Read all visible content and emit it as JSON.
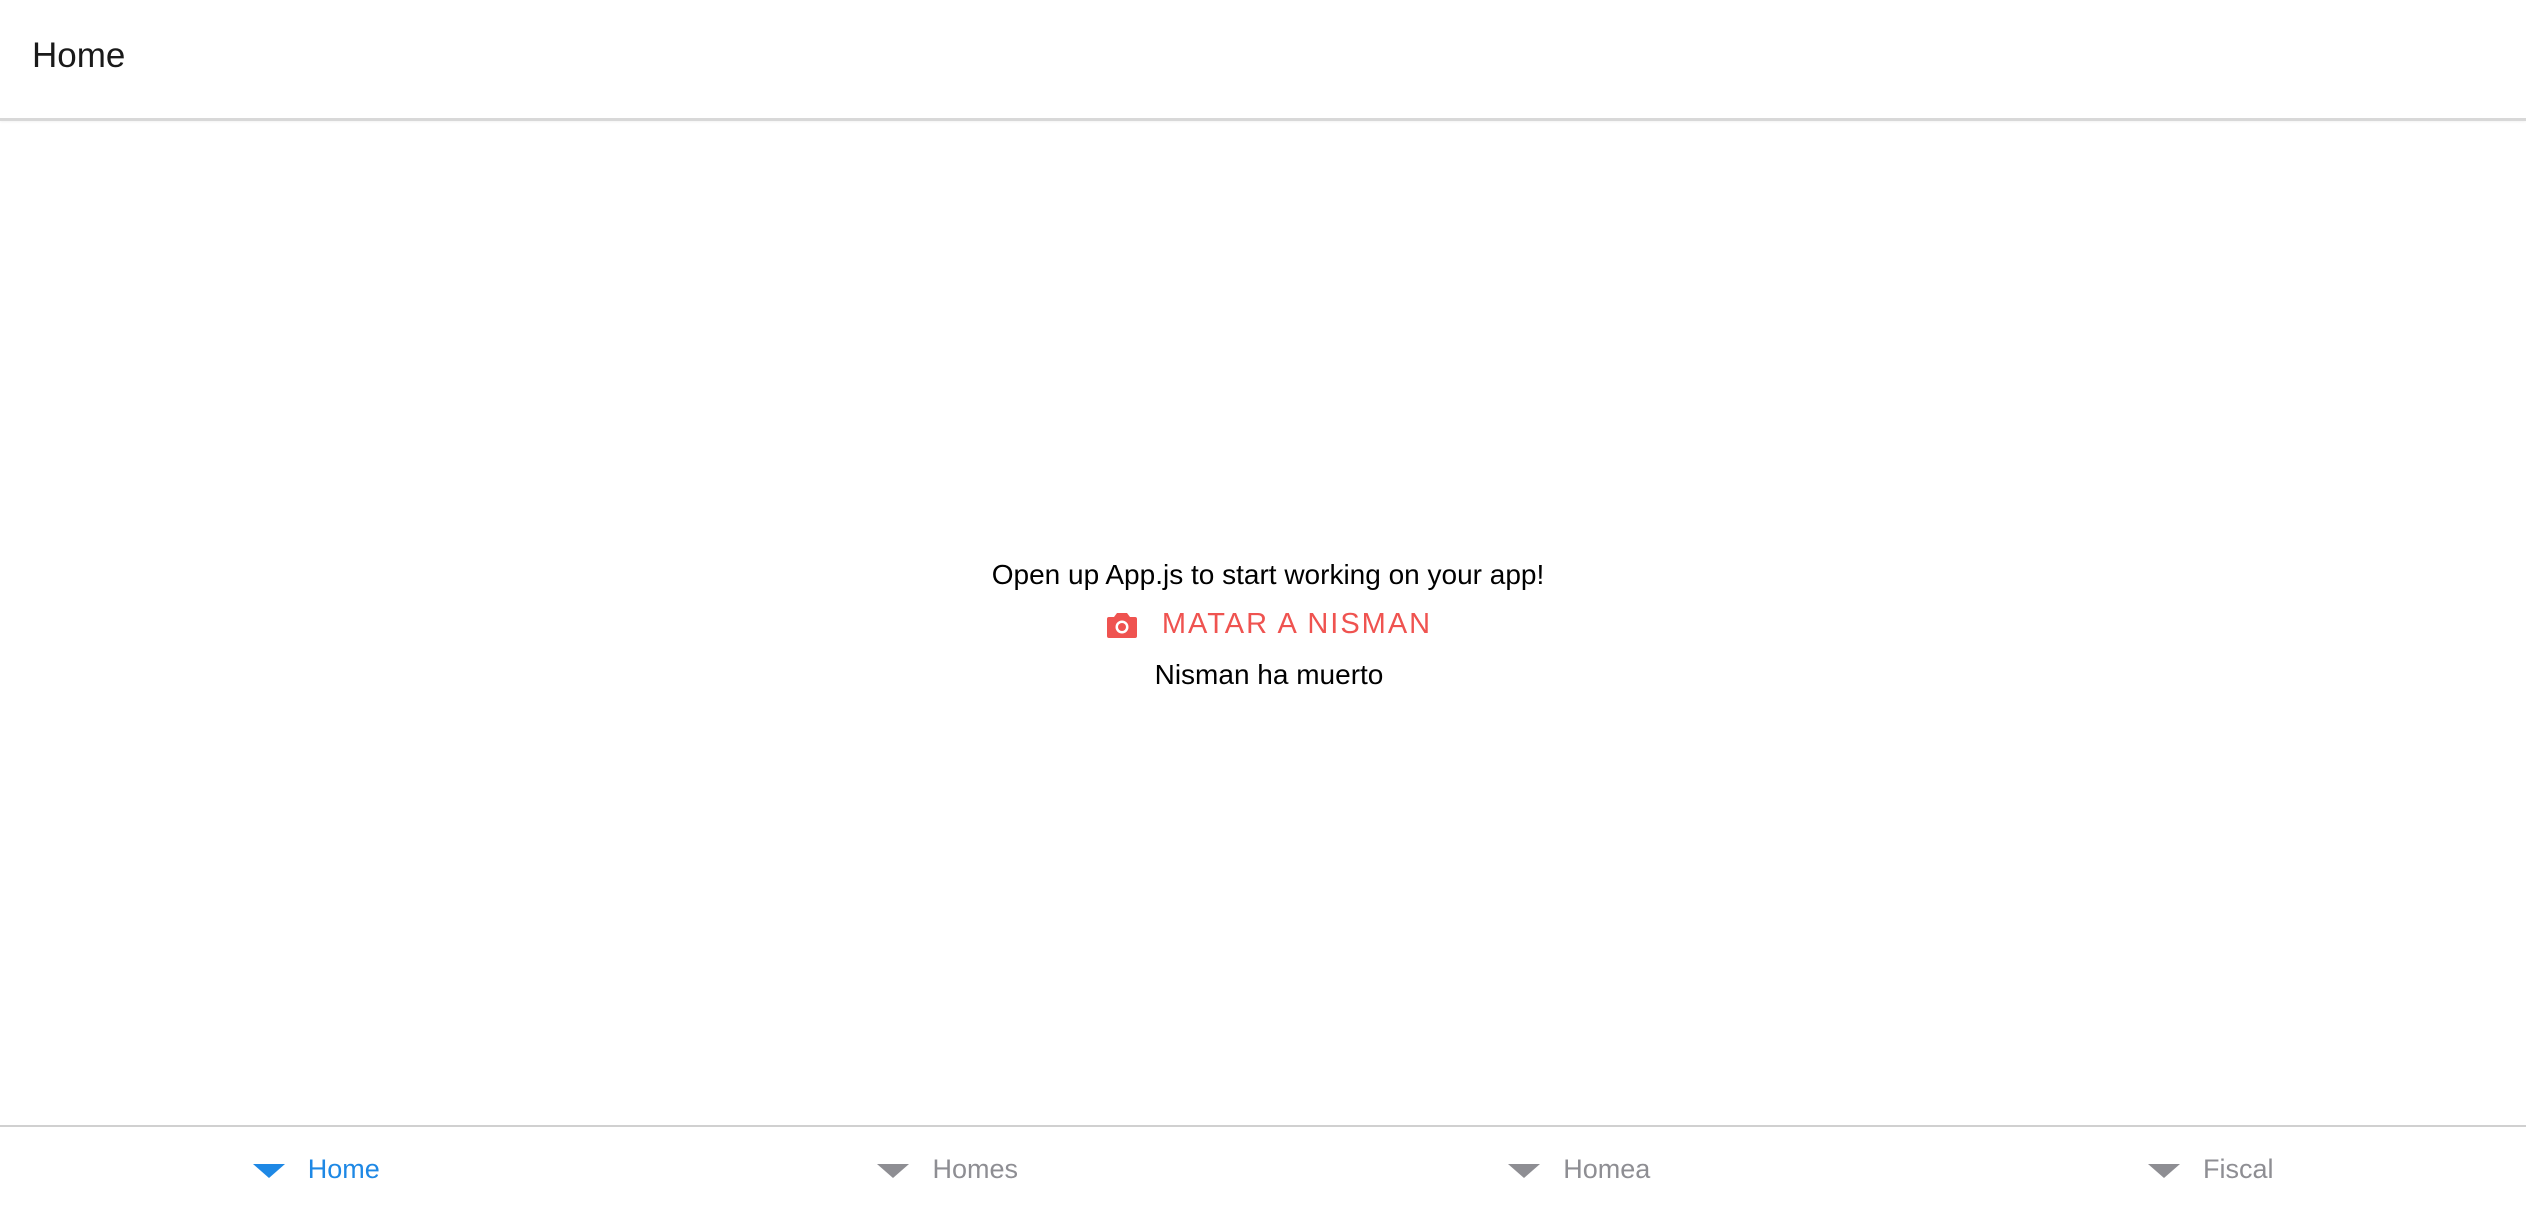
{
  "header": {
    "title": "Home"
  },
  "main": {
    "intro_text": "Open up App.js to start working on your app!",
    "action_button": {
      "label": "MATAR A NISMAN",
      "icon": "camera-icon",
      "color": "#ef5350"
    },
    "status_text": "Nisman ha muerto"
  },
  "tabbar": {
    "active_color": "#1e88e5",
    "inactive_color": "#8e8e93",
    "tabs": [
      {
        "label": "Home",
        "icon": "triangle-down-icon",
        "active": true
      },
      {
        "label": "Homes",
        "icon": "triangle-down-icon",
        "active": false
      },
      {
        "label": "Homea",
        "icon": "triangle-down-icon",
        "active": false
      },
      {
        "label": "Fiscal",
        "icon": "triangle-down-icon",
        "active": false
      }
    ]
  }
}
